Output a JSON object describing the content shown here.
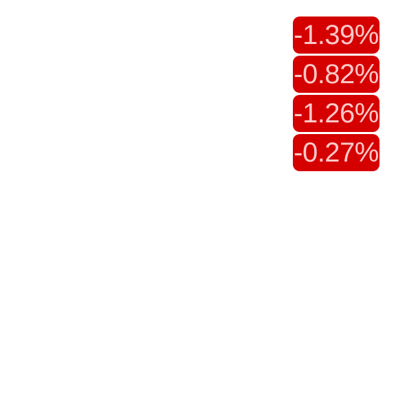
{
  "price_changes": {
    "items": [
      {
        "label": "-1.39%"
      },
      {
        "label": "-0.82%"
      },
      {
        "label": "-1.26%"
      },
      {
        "label": "-0.27%"
      }
    ],
    "badge_color": "#d50000",
    "text_color": "#ffc9c9"
  }
}
